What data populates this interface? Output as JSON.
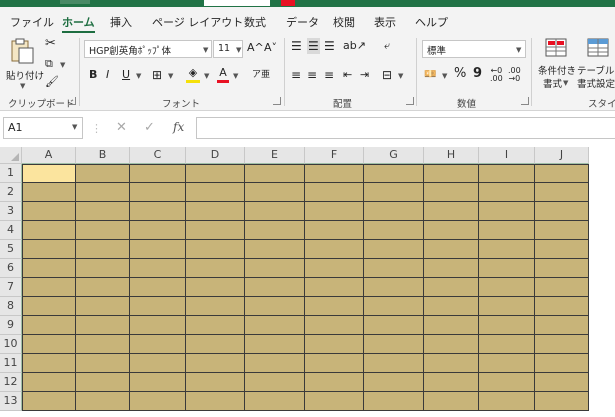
{
  "menu": {
    "tabs": [
      {
        "label": "ファイル"
      },
      {
        "label": "ホーム"
      },
      {
        "label": "挿入"
      },
      {
        "label": "ページ レイアウト"
      },
      {
        "label": "数式"
      },
      {
        "label": "データ"
      },
      {
        "label": "校閲"
      },
      {
        "label": "表示"
      },
      {
        "label": "ヘルプ"
      }
    ],
    "active_tab": "ホーム"
  },
  "ribbon": {
    "clipboard": {
      "paste_label": "貼り付け",
      "group_label": "クリップボード"
    },
    "font": {
      "font_name": "HGP創英角ﾎﾟｯﾌﾟ体",
      "font_size": "11",
      "grow_label": "A^",
      "shrink_label": "A˅",
      "bold": "B",
      "italic": "I",
      "underline": "U",
      "font_color_letter": "A",
      "group_label": "フォント"
    },
    "alignment": {
      "group_label": "配置"
    },
    "number": {
      "format_value": "標準",
      "percent": "%",
      "comma": "9",
      "group_label": "数値"
    },
    "styles": {
      "conditional_label_line1": "条件付き",
      "conditional_label_line2": "書式",
      "table_label_line1": "テーブルと",
      "table_label_line2": "書式設定",
      "group_label": "スタイル"
    }
  },
  "formula_bar": {
    "name_box": "A1",
    "fx_label": "fx",
    "formula": ""
  },
  "sheet": {
    "columns": [
      "A",
      "B",
      "C",
      "D",
      "E",
      "F",
      "G",
      "H",
      "I",
      "J"
    ],
    "rows": [
      "1",
      "2",
      "3",
      "4",
      "5",
      "6",
      "7",
      "8",
      "9",
      "10",
      "11",
      "12",
      "13"
    ],
    "active_cell": "A1",
    "colors": {
      "cell_fill": "#c8b479",
      "active_fill": "#fbe49e",
      "accent": "#217346"
    }
  }
}
